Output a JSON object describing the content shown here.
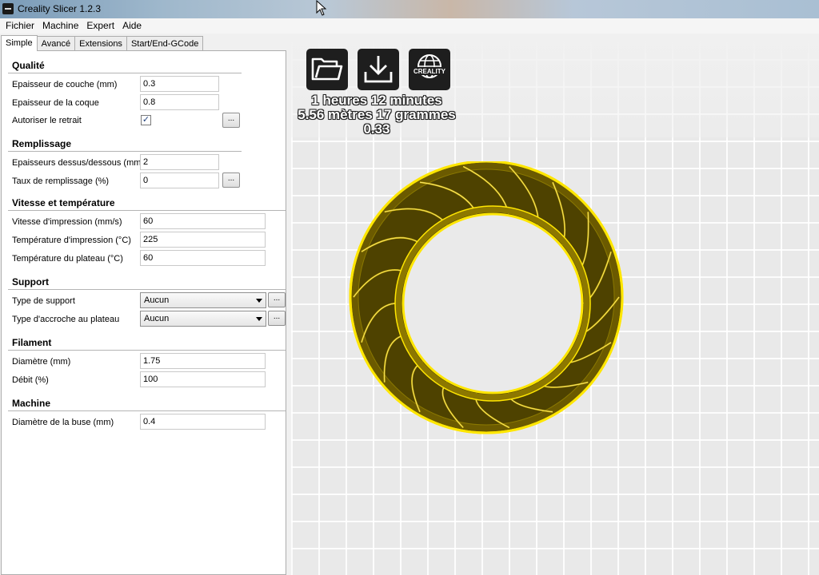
{
  "window": {
    "title": "Creality Slicer 1.2.3"
  },
  "menu": [
    "Fichier",
    "Machine",
    "Expert",
    "Aide"
  ],
  "tabs": [
    "Simple",
    "Avancé",
    "Extensions",
    "Start/End-GCode"
  ],
  "sections": {
    "qualite": {
      "title": "Qualité",
      "layer_height_label": "Epaisseur de couche (mm)",
      "layer_height": "0.3",
      "shell_label": "Epaisseur de la coque",
      "shell": "0.8",
      "retract_label": "Autoriser le retrait",
      "retract_checked": "✓",
      "more": "..."
    },
    "remplissage": {
      "title": "Remplissage",
      "topbottom_label": "Epaisseurs dessus/dessous (mm)",
      "topbottom": "2",
      "fill_label": "Taux de remplissage (%)",
      "fill": "0",
      "more": "..."
    },
    "vitesse": {
      "title": "Vitesse et température",
      "speed_label": "Vitesse d'impression (mm/s)",
      "speed": "60",
      "temp_label": "Température d'impression (°C)",
      "temp": "225",
      "bed_label": "Température du plateau (°C)",
      "bed": "60"
    },
    "support": {
      "title": "Support",
      "type_label": "Type de support",
      "type": "Aucun",
      "adhesion_label": "Type d'accroche au plateau",
      "adhesion": "Aucun",
      "more": "..."
    },
    "filament": {
      "title": "Filament",
      "diameter_label": "Diamètre (mm)",
      "diameter": "1.75",
      "flow_label": "Débit (%)",
      "flow": "100"
    },
    "machine": {
      "title": "Machine",
      "nozzle_label": "Diamètre de la buse (mm)",
      "nozzle": "0.4"
    }
  },
  "viewport": {
    "creality_logo_text": "CREALITY",
    "time": "1 heures 12 minutes",
    "material": "5.56 mètres 17 grammes",
    "cost": "0.33",
    "model_color": "#ffe600",
    "model_shade": "#6b5a00",
    "icons": [
      "folder-icon",
      "download-icon",
      "creality-globe-icon"
    ]
  }
}
